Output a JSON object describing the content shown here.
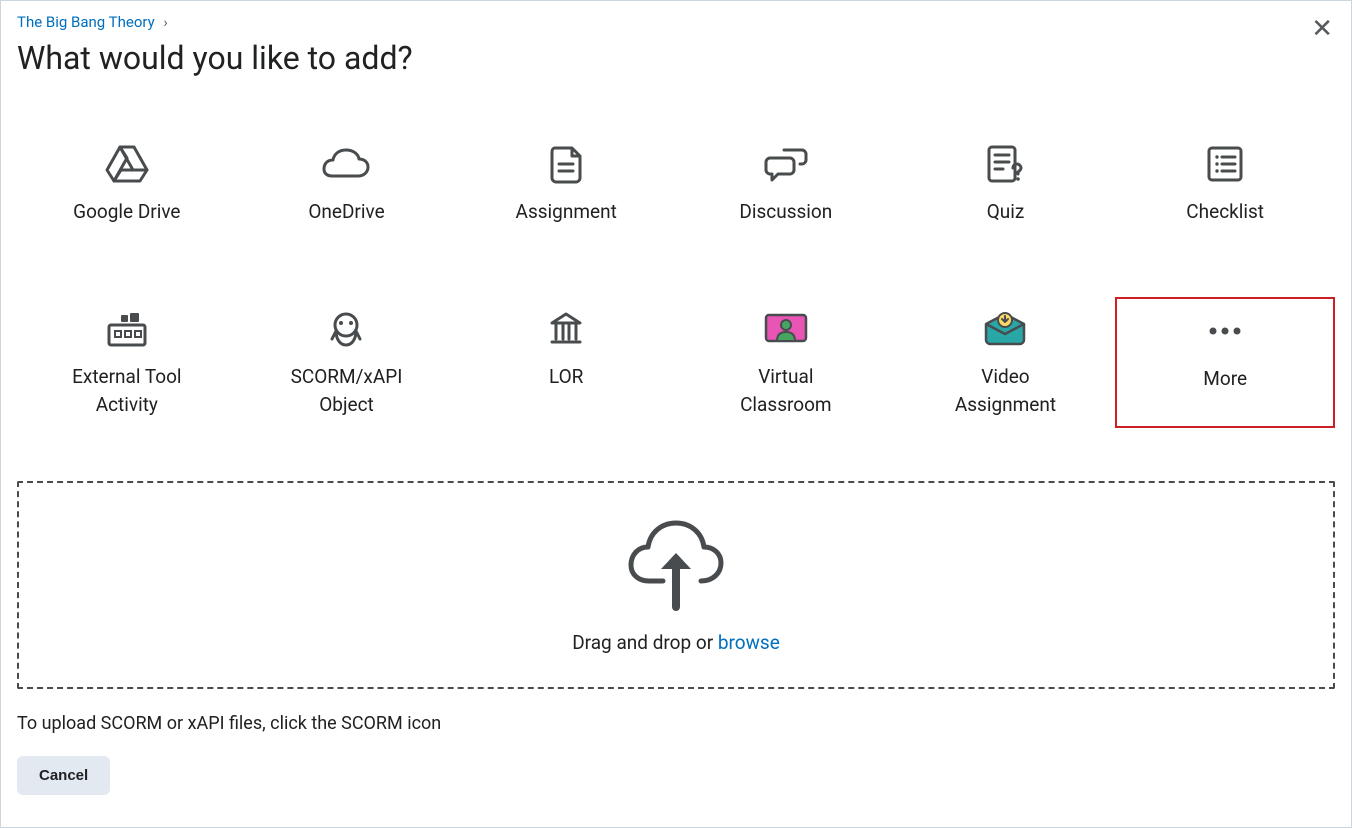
{
  "breadcrumb": {
    "course": "The Big Bang Theory"
  },
  "title": "What would you like to add?",
  "tiles": {
    "googleDrive": "Google Drive",
    "oneDrive": "OneDrive",
    "assignment": "Assignment",
    "discussion": "Discussion",
    "quiz": "Quiz",
    "checklist": "Checklist",
    "externalTool": "External Tool Activity",
    "scorm": "SCORM/xAPI Object",
    "lor": "LOR",
    "virtualClassroom": "Virtual Classroom",
    "videoAssignment": "Video Assignment",
    "more": "More"
  },
  "dropzone": {
    "textPrefix": "Drag and drop or ",
    "browse": "browse"
  },
  "hint": "To upload SCORM or xAPI files, click the SCORM icon",
  "buttons": {
    "cancel": "Cancel"
  }
}
